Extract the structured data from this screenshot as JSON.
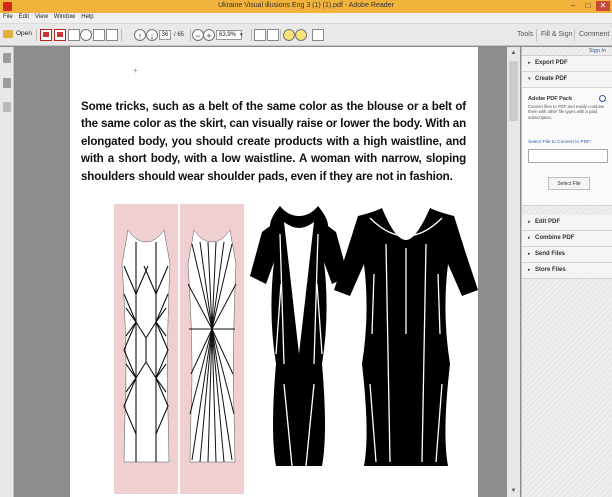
{
  "window": {
    "title": "Ukraine  Visual illusions Eng 3 (1) (1).pdf - Adobe Reader",
    "controls": [
      "–",
      "□",
      "✕"
    ]
  },
  "menu": [
    "File",
    "Edit",
    "View",
    "Window",
    "Help"
  ],
  "toolbar": {
    "open_label": "Open",
    "page_current": "36",
    "page_total": "/ 65",
    "zoom": "63,9%",
    "tabs": [
      "Tools",
      "Fill & Sign",
      "Comment"
    ]
  },
  "document": {
    "body_text": "Some tricks, such as a belt of the same color as the blouse or a belt of the same color as the skirt, can visually raise or lower the body. With an elongated body, you should create products with a high waistline, and with a short body, with a low waistline. A woman with narrow, sloping shoulders should wear shoulder pads, even if they are not in fashion.",
    "figure_colors": {
      "pink": "#efcfd0",
      "black": "#000000",
      "white": "#ffffff"
    }
  },
  "right_panel": {
    "sign_in": "Sign In",
    "sections": [
      {
        "label": "Export PDF",
        "chevron": "▸"
      },
      {
        "label": "Create PDF",
        "chevron": "▾"
      }
    ],
    "create": {
      "heading": "Adobe PDF Pack",
      "description": "Convert files to PDF and easily combine them with other file types with a paid subscription.",
      "select_label": "Select File to Convert to PDF:",
      "button": "Select File"
    },
    "more_sections": [
      {
        "label": "Edit PDF",
        "chevron": "▸"
      },
      {
        "label": "Combine PDF",
        "chevron": "▸"
      },
      {
        "label": "Send Files",
        "chevron": "▸"
      },
      {
        "label": "Store Files",
        "chevron": "▸"
      }
    ]
  },
  "colors": {
    "titlebar": "#f2b33d",
    "accent": "#2b5ea7"
  }
}
